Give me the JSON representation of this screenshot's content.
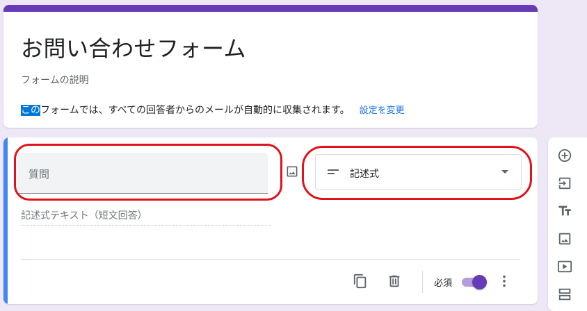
{
  "header": {
    "form_title": "お問い合わせフォーム",
    "form_description_placeholder": "フォームの説明",
    "email_notice_highlight": "この",
    "email_notice_rest": "フォームでは、すべての回答者からのメールが自動的に収集されます。",
    "change_settings_link": "設定を変更"
  },
  "question": {
    "title_placeholder": "質問",
    "type_label": "記述式",
    "answer_placeholder": "記述式テキスト（短文回答）",
    "required_label": "必須",
    "required_on": true
  },
  "colors": {
    "theme": "#673ab7",
    "background": "#ede7f6",
    "accent_blue": "#4285f4",
    "annotation_red": "#e0121b"
  },
  "icons": {
    "image": "image-icon",
    "short_answer": "short-answer-icon",
    "dropdown": "dropdown-arrow-icon",
    "duplicate": "duplicate-icon",
    "delete": "trash-icon",
    "more": "more-vert-icon",
    "toolbar": [
      "add-question-icon",
      "import-questions-icon",
      "add-title-icon",
      "add-image-icon",
      "add-video-icon",
      "add-section-icon"
    ]
  }
}
